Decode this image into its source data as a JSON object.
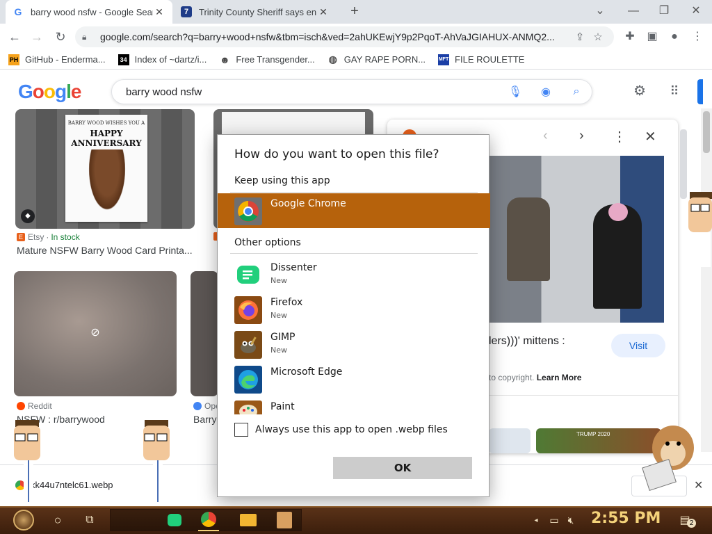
{
  "browser": {
    "tabs": [
      {
        "title": "barry wood nsfw - Google Search",
        "favicon": "G",
        "active": true
      },
      {
        "title": "Trinity County Sheriff says en",
        "favicon": "7",
        "active": false
      }
    ],
    "new_tab": "+",
    "url": "google.com/search?q=barry+wood+nsfw&tbm=isch&ved=2ahUKEwjY9p2PqoT-AhVaJGIAHUX-ANMQ2...",
    "bookmarks": [
      {
        "label": "GitHub - Enderma...",
        "icon": "PH"
      },
      {
        "label": "Index of ~dartz/i...",
        "icon": "34"
      },
      {
        "label": "Free Transgender...",
        "icon": "mask-icon"
      },
      {
        "label": "GAY RAPE PORN...",
        "icon": "globe-icon"
      },
      {
        "label": "FILE ROULETTE",
        "icon": "MFT"
      }
    ]
  },
  "google": {
    "logo": [
      "G",
      "o",
      "o",
      "g",
      "l",
      "e"
    ],
    "logo_colors": [
      "#4285f4",
      "#ea4335",
      "#fbbc05",
      "#4285f4",
      "#34a853",
      "#ea4335"
    ],
    "query": "barry wood nsfw"
  },
  "results": [
    {
      "source": "Etsy",
      "badge": "In stock",
      "title": "Mature NSFW Barry Wood Card Printa...",
      "card_line1": "BARRY WOOD WISHES YOU A",
      "card_line2": "HAPPY ANNIVERSARY"
    },
    {
      "source": "Reddit",
      "title": "NSFW : r/barrywood"
    },
    {
      "source": "Ope",
      "title": "Barry"
    }
  ],
  "side_panel": {
    "caption_fragment": "lers)))' mittens :",
    "visit_label": "Visit",
    "copyright_text": "to copyright.",
    "learn_more": "Learn More",
    "bottom_thumb_text": "TRUMP 2020"
  },
  "dialog": {
    "title": "How do you want to open this file?",
    "keep_label": "Keep using this app",
    "selected_app": "Google Chrome",
    "other_label": "Other options",
    "apps": [
      {
        "name": "Dissenter",
        "tag": "New"
      },
      {
        "name": "Firefox",
        "tag": "New"
      },
      {
        "name": "GIMP",
        "tag": "New"
      },
      {
        "name": "Microsoft Edge",
        "tag": ""
      },
      {
        "name": "Paint",
        "tag": ""
      }
    ],
    "always_label": "Always use this app to open .webp files",
    "ok_label": "OK"
  },
  "download": {
    "filename": "xk44u7ntelc61.webp"
  },
  "taskbar": {
    "time": "2:55 PM",
    "notification_count": "2"
  }
}
